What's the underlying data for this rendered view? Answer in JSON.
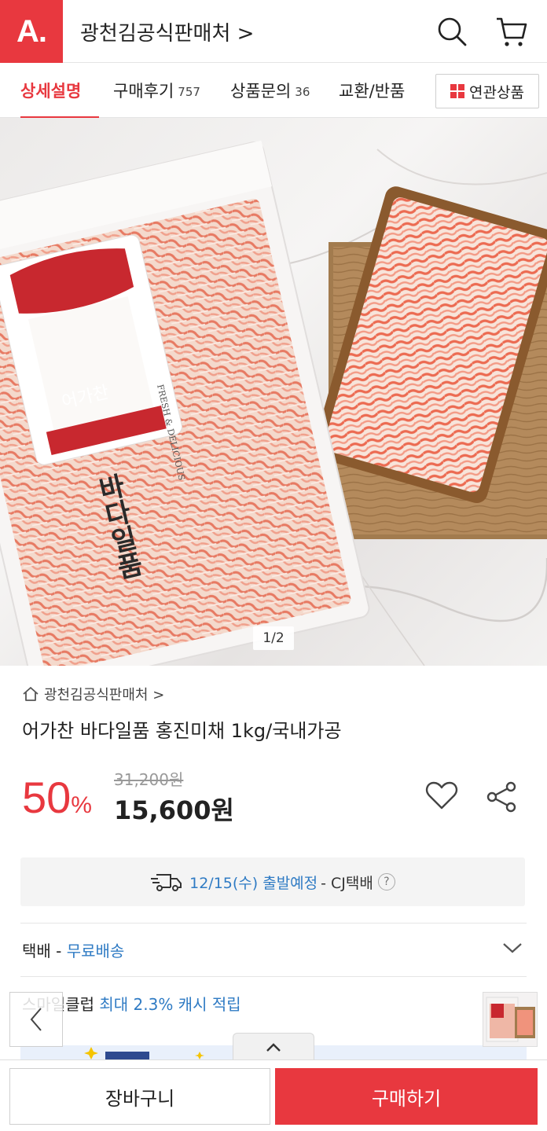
{
  "header": {
    "logo_text": "A.",
    "store_name": "광천김공식판매처 >",
    "icons": [
      "search-icon",
      "cart-icon"
    ]
  },
  "tabs": [
    {
      "label": "상세설명",
      "count": "",
      "active": true
    },
    {
      "label": "구매후기",
      "count": "757",
      "active": false
    },
    {
      "label": "상품문의",
      "count": "36",
      "active": false
    },
    {
      "label": "교환/반품",
      "count": "",
      "active": false
    }
  ],
  "related_button": "연관상품",
  "hero": {
    "counter": "1/2",
    "package_brand": "어가찬",
    "package_name": "바다일품",
    "package_side": "FRESH & DELICIOUS"
  },
  "product": {
    "breadcrumb": "광천김공식판매처 >",
    "title": "어가찬 바다일품 홍진미채 1kg/국내가공",
    "discount": "50",
    "discount_unit": "%",
    "original_price": "31,200원",
    "sale_price": "15,600원"
  },
  "shipping": {
    "date_text": "12/15(수) 출발예정",
    "carrier_text": "- CJ택배",
    "help": "?"
  },
  "delivery": {
    "label": "택배 -",
    "value": "무료배송"
  },
  "club": {
    "label": "스마일클럽",
    "value": "최대 2.3% 캐시 적립"
  },
  "bottom": {
    "cart_label": "장바구니",
    "buy_label": "구매하기"
  },
  "colors": {
    "accent": "#e8383f",
    "link_blue": "#2f7bc4"
  }
}
